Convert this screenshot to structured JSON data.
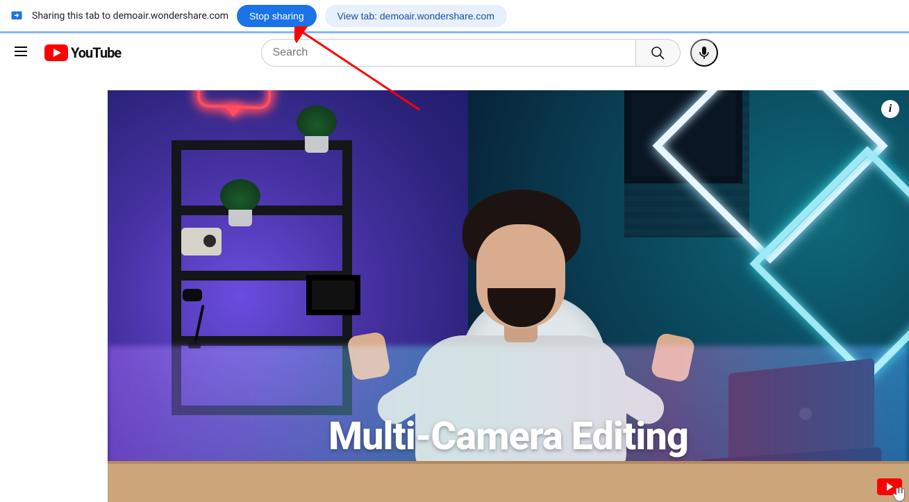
{
  "sharebar": {
    "label": "Sharing this tab to demoair.wondershare.com",
    "stop_label": "Stop sharing",
    "view_label": "View tab: demoair.wondershare.com"
  },
  "header": {
    "logo_text": "YouTube",
    "search_placeholder": "Search"
  },
  "video": {
    "caption": "Multi-Camera Editing",
    "info_glyph": "i"
  }
}
